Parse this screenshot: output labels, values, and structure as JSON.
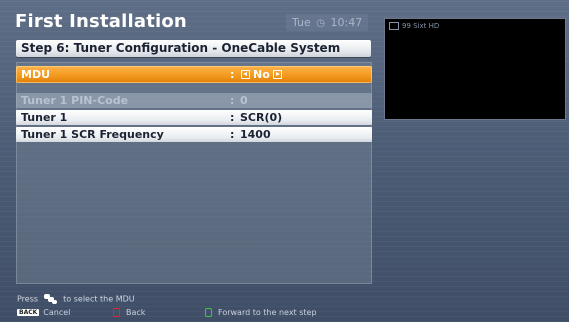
{
  "header": {
    "title": "First Installation",
    "day": "Tue",
    "time": "10:47",
    "clock_icon": "clock-icon"
  },
  "step": {
    "title": "Step 6: Tuner Configuration - OneCable System"
  },
  "settings": [
    {
      "label": "MDU",
      "separator": ":",
      "value": "No",
      "state": "selected"
    },
    {
      "label": "Tuner 1 PIN-Code",
      "separator": ":",
      "value": "0",
      "state": "disabled"
    },
    {
      "label": "Tuner 1",
      "separator": ":",
      "value": "SCR(0)",
      "state": "normal"
    },
    {
      "label": "Tuner 1 SCR Frequency",
      "separator": ":",
      "value": "1400",
      "state": "normal"
    }
  ],
  "preview": {
    "channel_label": "99 Sixt HD"
  },
  "hint": {
    "prefix": "Press",
    "suffix": "to select the MDU"
  },
  "footer": {
    "back_key": "BACK",
    "cancel": "Cancel",
    "back": "Back",
    "forward": "Forward to the next step"
  },
  "colors": {
    "accent": "#f39a1f",
    "background": "#4d5d76",
    "red_key": "#e0262a",
    "green_key": "#3ccc3a"
  }
}
